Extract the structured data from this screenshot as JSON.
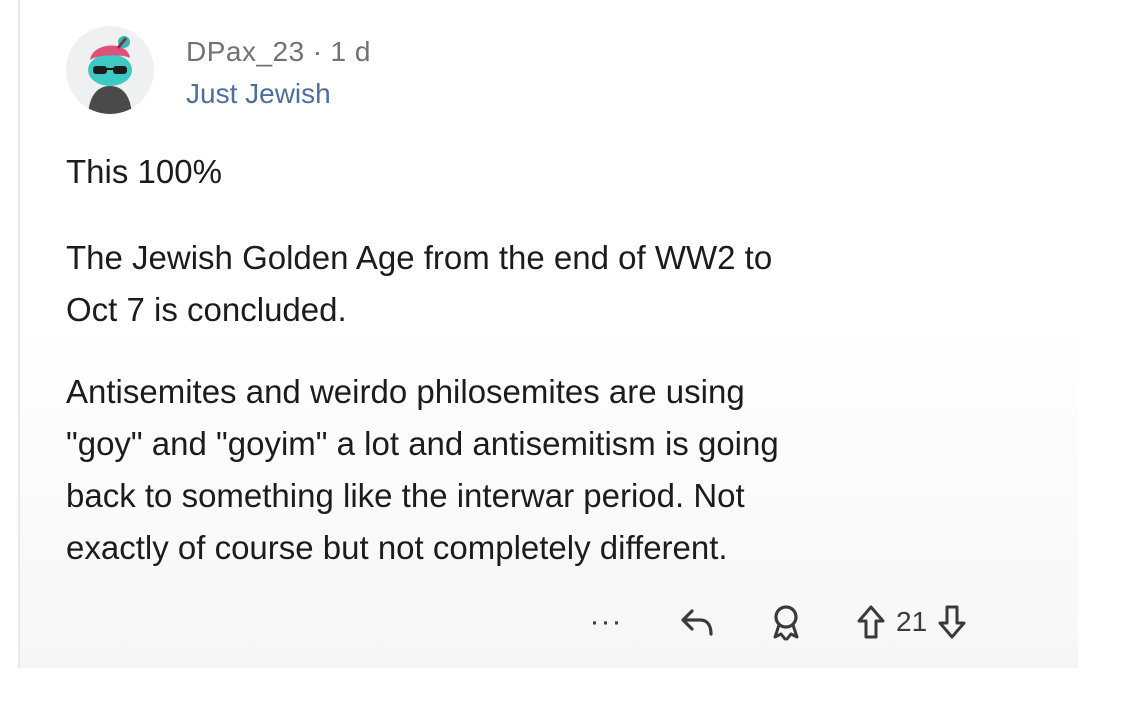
{
  "comment": {
    "author": "DPax_23",
    "separator": "·",
    "age": "1 d",
    "flair": "Just Jewish",
    "paragraphs": [
      "This 100%",
      "The Jewish Golden Age from the end of WW2 to\nOct 7 is concluded.",
      "Antisemites and weirdo philosemites are using\n\"goy\" and \"goyim\" a lot and antisemitism is going\nback to something like the interwar period. Not\nexactly of course but not completely different."
    ]
  },
  "actions": {
    "more_label": "···",
    "score": "21",
    "icons": [
      "more-icon",
      "reply-icon",
      "award-icon",
      "upvote-icon",
      "downvote-icon"
    ]
  },
  "colors": {
    "meta": "#6f7378",
    "flair": "#4d6f9e",
    "text": "#1c1c1e",
    "avatar_hair": "#e0507a",
    "avatar_face": "#3ec9c2"
  }
}
